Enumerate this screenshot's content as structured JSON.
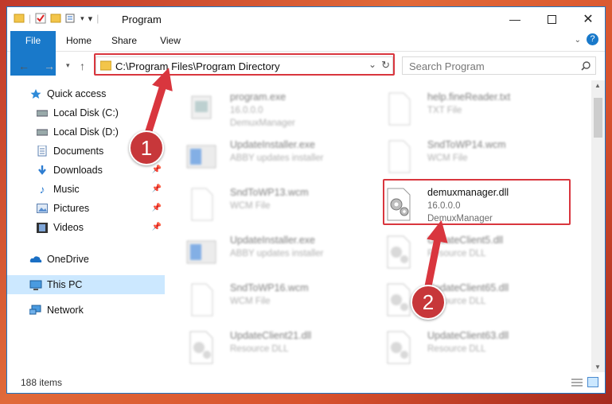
{
  "window": {
    "title": "Program"
  },
  "ribbon": {
    "tabs": [
      "File",
      "Home",
      "Share",
      "View"
    ]
  },
  "address": {
    "path": "C:\\Program Files\\Program Directory"
  },
  "search": {
    "placeholder": "Search Program"
  },
  "sidebar": {
    "items": [
      {
        "label": "Quick access",
        "icon": "star-icon",
        "pinned": false
      },
      {
        "label": "Local Disk (C:)",
        "icon": "drive-icon",
        "pinned": false
      },
      {
        "label": "Local Disk (D:)",
        "icon": "drive-icon",
        "pinned": false
      },
      {
        "label": "Documents",
        "icon": "documents-icon",
        "pinned": false
      },
      {
        "label": "Downloads",
        "icon": "download-icon",
        "pinned": true
      },
      {
        "label": "Music",
        "icon": "music-icon",
        "pinned": true
      },
      {
        "label": "Pictures",
        "icon": "pictures-icon",
        "pinned": true
      },
      {
        "label": "Videos",
        "icon": "videos-icon",
        "pinned": true
      },
      {
        "label": "OneDrive",
        "icon": "cloud-icon",
        "pinned": false
      },
      {
        "label": "This PC",
        "icon": "computer-icon",
        "pinned": false,
        "selected": true
      },
      {
        "label": "Network",
        "icon": "network-icon",
        "pinned": false
      }
    ]
  },
  "files": [
    {
      "name": "program.exe",
      "line2": "16.0.0.0",
      "line3": "DemuxManager",
      "icon": "exe-icon"
    },
    {
      "name": "help.fineReader.txt",
      "line2": "TXT File",
      "line3": "",
      "icon": "text-file-icon"
    },
    {
      "name": "UpdateInstaller.exe",
      "line2": "ABBY updates installer",
      "line3": "",
      "icon": "installer-icon"
    },
    {
      "name": "SndToWP14.wcm",
      "line2": "WCM File",
      "line3": "",
      "icon": "blank-file-icon"
    },
    {
      "name": "SndToWP13.wcm",
      "line2": "WCM File",
      "line3": "",
      "icon": "blank-file-icon"
    },
    {
      "name": "demuxmanager.dll",
      "line2": "16.0.0.0",
      "line3": "DemuxManager",
      "icon": "dll-gear-icon"
    },
    {
      "name": "UpdateInstaller.exe",
      "line2": "ABBY updates installer",
      "line3": "",
      "icon": "installer-icon"
    },
    {
      "name": "UpdateClient5.dll",
      "line2": "Resource DLL",
      "line3": "",
      "icon": "dll-gear-icon"
    },
    {
      "name": "SndToWP16.wcm",
      "line2": "WCM File",
      "line3": "",
      "icon": "blank-file-icon"
    },
    {
      "name": "UpdateClient65.dll",
      "line2": "Resource DLL",
      "line3": "",
      "icon": "dll-gear-icon"
    },
    {
      "name": "UpdateClient21.dll",
      "line2": "Resource DLL",
      "line3": "",
      "icon": "dll-gear-icon"
    },
    {
      "name": "UpdateClient63.dll",
      "line2": "Resource DLL",
      "line3": "",
      "icon": "dll-gear-icon"
    }
  ],
  "status": {
    "count": "188 items"
  },
  "callouts": [
    "1",
    "2"
  ],
  "colors": {
    "accent": "#1979ca",
    "highlight": "#d9363e",
    "badge": "#c7373a",
    "selected": "#cce8ff"
  }
}
